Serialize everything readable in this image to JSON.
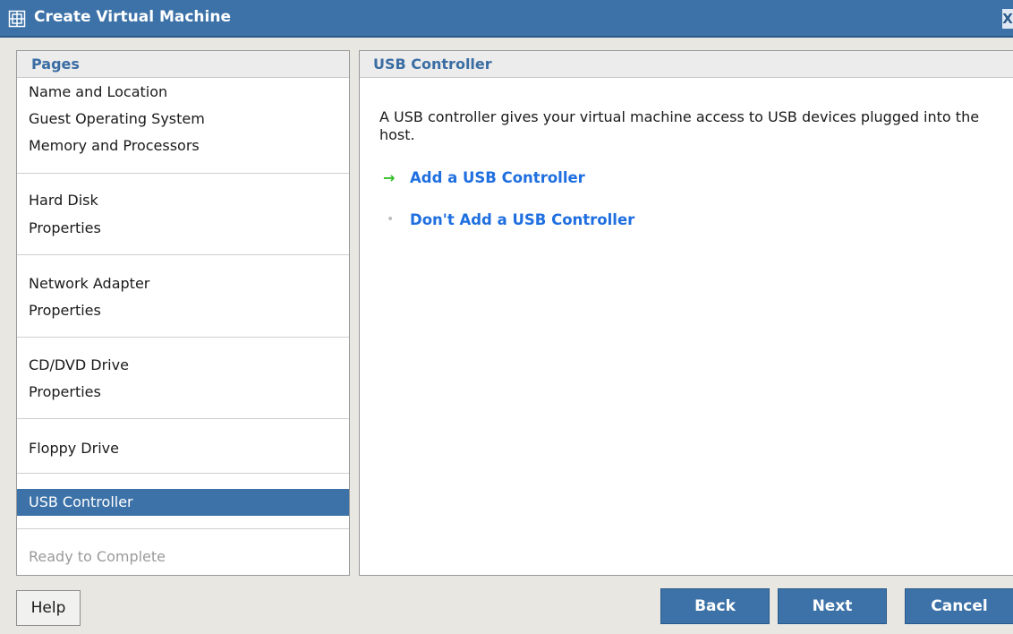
{
  "window": {
    "title": "Create Virtual Machine",
    "title_icon": "virtual-machine-icon",
    "close_label": "X"
  },
  "pages": {
    "header": "Pages",
    "items": [
      {
        "label": "Name and Location",
        "state": "normal"
      },
      {
        "label": "Guest Operating System",
        "state": "normal"
      },
      {
        "label": "Memory and Processors",
        "state": "normal"
      },
      {
        "label": "Hard Disk",
        "state": "normal"
      },
      {
        "label": "Properties",
        "state": "normal"
      },
      {
        "label": "Network Adapter",
        "state": "normal"
      },
      {
        "label": "Properties",
        "state": "normal"
      },
      {
        "label": "CD/DVD Drive",
        "state": "normal"
      },
      {
        "label": "Properties",
        "state": "normal"
      },
      {
        "label": "Floppy Drive",
        "state": "normal"
      },
      {
        "label": "USB Controller",
        "state": "selected"
      },
      {
        "label": "Ready to Complete",
        "state": "disabled"
      }
    ]
  },
  "content": {
    "header": "USB Controller",
    "description": "A USB controller gives your virtual machine access to USB devices plugged into the host.",
    "options": [
      {
        "label": "Add a USB Controller",
        "bullet": "→",
        "icon": "green-arrow-icon"
      },
      {
        "label": "Don't Add a USB Controller",
        "bullet": "•",
        "icon": "grey-dot-icon"
      }
    ]
  },
  "buttons": {
    "help": "Help",
    "back": "Back",
    "next": "Next",
    "cancel": "Cancel"
  },
  "colors": {
    "titlebar": "#3d72a8",
    "selected": "#3d72a8",
    "link": "#1f6fe0",
    "accent_arrow": "#2fbf24"
  }
}
